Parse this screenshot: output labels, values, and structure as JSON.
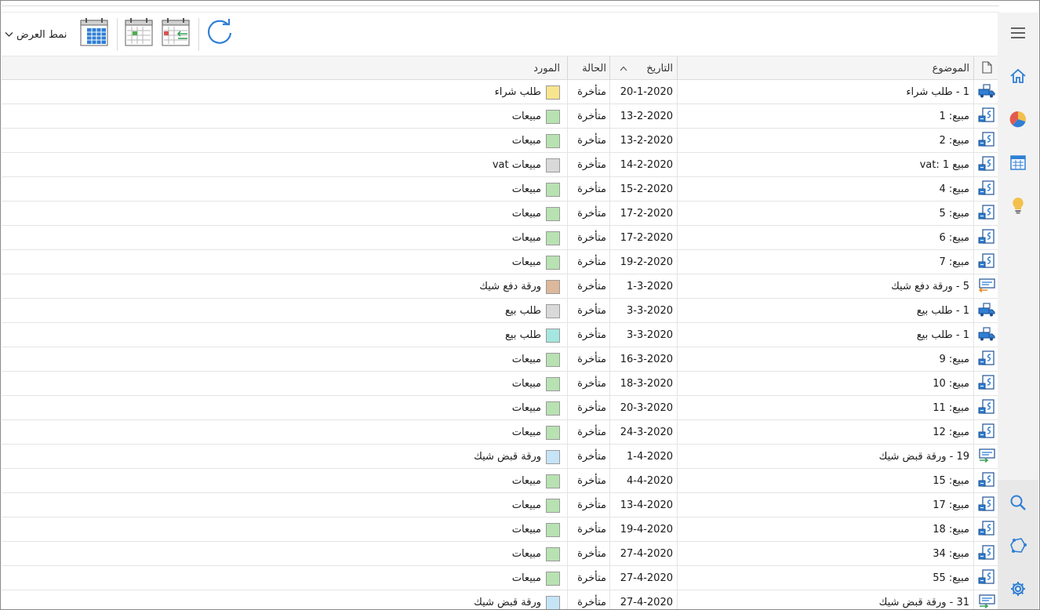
{
  "toolbar": {
    "view_mode_label": "نمط العرض",
    "icons": [
      "refresh-icon",
      "calendar-transfer-icon",
      "calendar-week-icon",
      "calendar-grid-icon",
      "chevron-down-icon"
    ]
  },
  "nav_rail": {
    "items": [
      "menu-icon",
      "home-icon",
      "pie-chart-icon",
      "calendar-icon",
      "lightbulb-icon",
      "search-icon",
      "shapes-icon",
      "settings-icon"
    ]
  },
  "table": {
    "columns": {
      "subject": "الموضوع",
      "date": "التاريخ",
      "status": "الحالة",
      "supplier": "المورد"
    },
    "rows": [
      {
        "icon": "truck",
        "subject": "1 - طلب شراء",
        "date": "20-1-2020",
        "status": "متأخرة",
        "supplier": "طلب شراء",
        "color": "#f7e58e"
      },
      {
        "icon": "invoice",
        "subject": "مبيع: 1",
        "date": "13-2-2020",
        "status": "متأخرة",
        "supplier": "مبيعات",
        "color": "#b8e2b2"
      },
      {
        "icon": "invoice",
        "subject": "مبيع: 2",
        "date": "13-2-2020",
        "status": "متأخرة",
        "supplier": "مبيعات",
        "color": "#b8e2b2"
      },
      {
        "icon": "invoice",
        "subject": "مبيع vat: 1",
        "date": "14-2-2020",
        "status": "متأخرة",
        "supplier": "مبيعات vat",
        "color": "#d9d9d9"
      },
      {
        "icon": "invoice",
        "subject": "مبيع: 4",
        "date": "15-2-2020",
        "status": "متأخرة",
        "supplier": "مبيعات",
        "color": "#b8e2b2"
      },
      {
        "icon": "invoice",
        "subject": "مبيع: 5",
        "date": "17-2-2020",
        "status": "متأخرة",
        "supplier": "مبيعات",
        "color": "#b8e2b2"
      },
      {
        "icon": "invoice",
        "subject": "مبيع: 6",
        "date": "17-2-2020",
        "status": "متأخرة",
        "supplier": "مبيعات",
        "color": "#b8e2b2"
      },
      {
        "icon": "invoice",
        "subject": "مبيع: 7",
        "date": "19-2-2020",
        "status": "متأخرة",
        "supplier": "مبيعات",
        "color": "#b8e2b2"
      },
      {
        "icon": "pay",
        "subject": "5 - ورقة دفع شيك",
        "date": "1-3-2020",
        "status": "متأخرة",
        "supplier": "ورقة دفع شيك",
        "color": "#dcb89c"
      },
      {
        "icon": "truck",
        "subject": "1 - طلب بيع",
        "date": "3-3-2020",
        "status": "متأخرة",
        "supplier": "طلب بيع",
        "color": "#d9d9d9"
      },
      {
        "icon": "truck",
        "subject": "1 - طلب بيع",
        "date": "3-3-2020",
        "status": "متأخرة",
        "supplier": "طلب بيع",
        "color": "#a5e6e0"
      },
      {
        "icon": "invoice",
        "subject": "مبيع: 9",
        "date": "16-3-2020",
        "status": "متأخرة",
        "supplier": "مبيعات",
        "color": "#b8e2b2"
      },
      {
        "icon": "invoice",
        "subject": "مبيع: 10",
        "date": "18-3-2020",
        "status": "متأخرة",
        "supplier": "مبيعات",
        "color": "#b8e2b2"
      },
      {
        "icon": "invoice",
        "subject": "مبيع: 11",
        "date": "20-3-2020",
        "status": "متأخرة",
        "supplier": "مبيعات",
        "color": "#b8e2b2"
      },
      {
        "icon": "invoice",
        "subject": "مبيع: 12",
        "date": "24-3-2020",
        "status": "متأخرة",
        "supplier": "مبيعات",
        "color": "#b8e2b2"
      },
      {
        "icon": "receive",
        "subject": "19 - ورقة قبض شيك",
        "date": "1-4-2020",
        "status": "متأخرة",
        "supplier": "ورقة قبض شيك",
        "color": "#c6e4f7"
      },
      {
        "icon": "invoice",
        "subject": "مبيع: 15",
        "date": "4-4-2020",
        "status": "متأخرة",
        "supplier": "مبيعات",
        "color": "#b8e2b2"
      },
      {
        "icon": "invoice",
        "subject": "مبيع: 17",
        "date": "13-4-2020",
        "status": "متأخرة",
        "supplier": "مبيعات",
        "color": "#b8e2b2"
      },
      {
        "icon": "invoice",
        "subject": "مبيع: 18",
        "date": "19-4-2020",
        "status": "متأخرة",
        "supplier": "مبيعات",
        "color": "#b8e2b2"
      },
      {
        "icon": "invoice",
        "subject": "مبيع: 34",
        "date": "27-4-2020",
        "status": "متأخرة",
        "supplier": "مبيعات",
        "color": "#b8e2b2"
      },
      {
        "icon": "invoice",
        "subject": "مبيع: 55",
        "date": "27-4-2020",
        "status": "متأخرة",
        "supplier": "مبيعات",
        "color": "#b8e2b2"
      },
      {
        "icon": "receive",
        "subject": "31 - ورقة قبض شيك",
        "date": "27-4-2020",
        "status": "متأخرة",
        "supplier": "ورقة قبض شيك",
        "color": "#c6e4f7"
      }
    ]
  }
}
